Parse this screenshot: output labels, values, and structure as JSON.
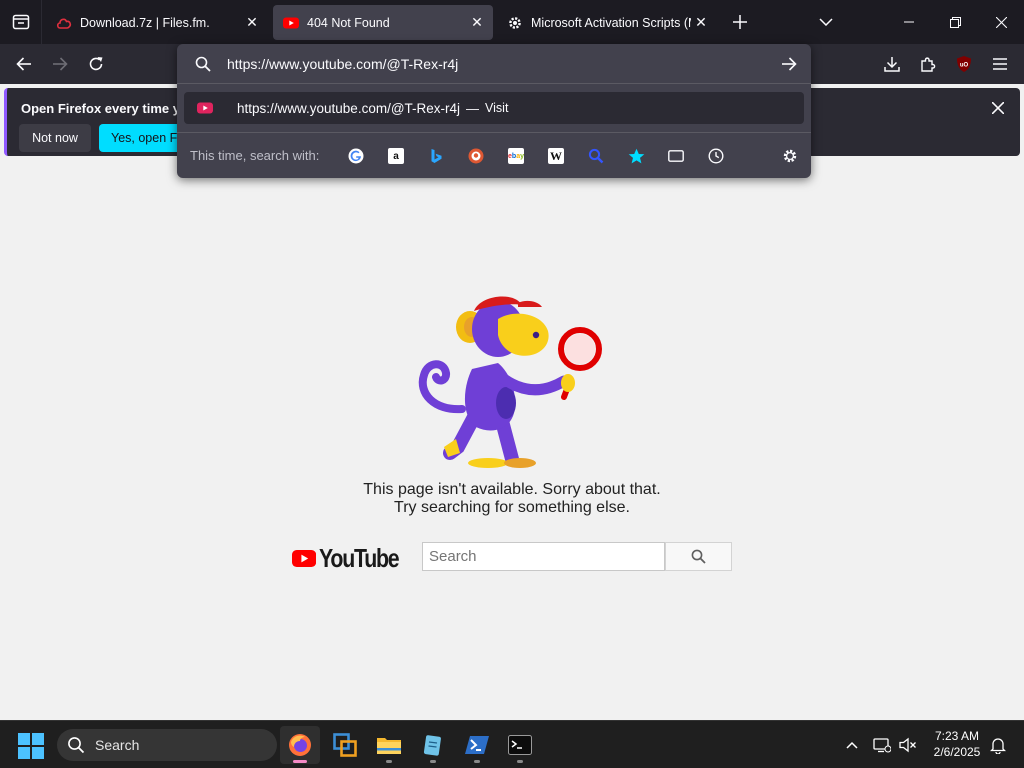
{
  "tabs": [
    {
      "title": "Download.7z | Files.fm.",
      "icon": "files-fm-icon",
      "active": false
    },
    {
      "title": "404 Not Found",
      "icon": "youtube-icon",
      "active": true
    },
    {
      "title": "Microsoft Activation Scripts (MAS)",
      "icon": "gear-icon",
      "active": false
    }
  ],
  "urlbar": {
    "value": "https://www.youtube.com/@T-Rex-r4j",
    "result": {
      "url": "https://www.youtube.com/@T-Rex-r4j",
      "separator": "—",
      "action": "Visit"
    },
    "engines_label": "This time, search with:",
    "engines": [
      "google",
      "amazon",
      "bing",
      "duckduckgo",
      "ebay",
      "wikipedia",
      "search",
      "bookmarks",
      "tabs",
      "history"
    ]
  },
  "notification": {
    "text": "Open Firefox every time you",
    "not_now": "Not now",
    "yes_open": "Yes, open Firefox"
  },
  "page": {
    "error_line1": "This page isn't available. Sorry about that.",
    "error_line2": "Try searching for something else.",
    "logo_text": "YouTube",
    "search_placeholder": "Search"
  },
  "taskbar": {
    "search_label": "Search",
    "apps": [
      "firefox",
      "virtualbox",
      "file-explorer",
      "notepad",
      "powershell",
      "terminal"
    ],
    "time": "7:23 AM",
    "date": "2/6/2025"
  },
  "colors": {
    "tabstrip_bg": "#1c1b22",
    "toolbar_bg": "#2b2a33",
    "urlbar_bg": "#42414d",
    "accent_cyan": "#00ddff",
    "youtube_red": "#ff0000",
    "monkey_purple": "#6f3fd6",
    "monkey_yellow": "#f9cf1b"
  }
}
